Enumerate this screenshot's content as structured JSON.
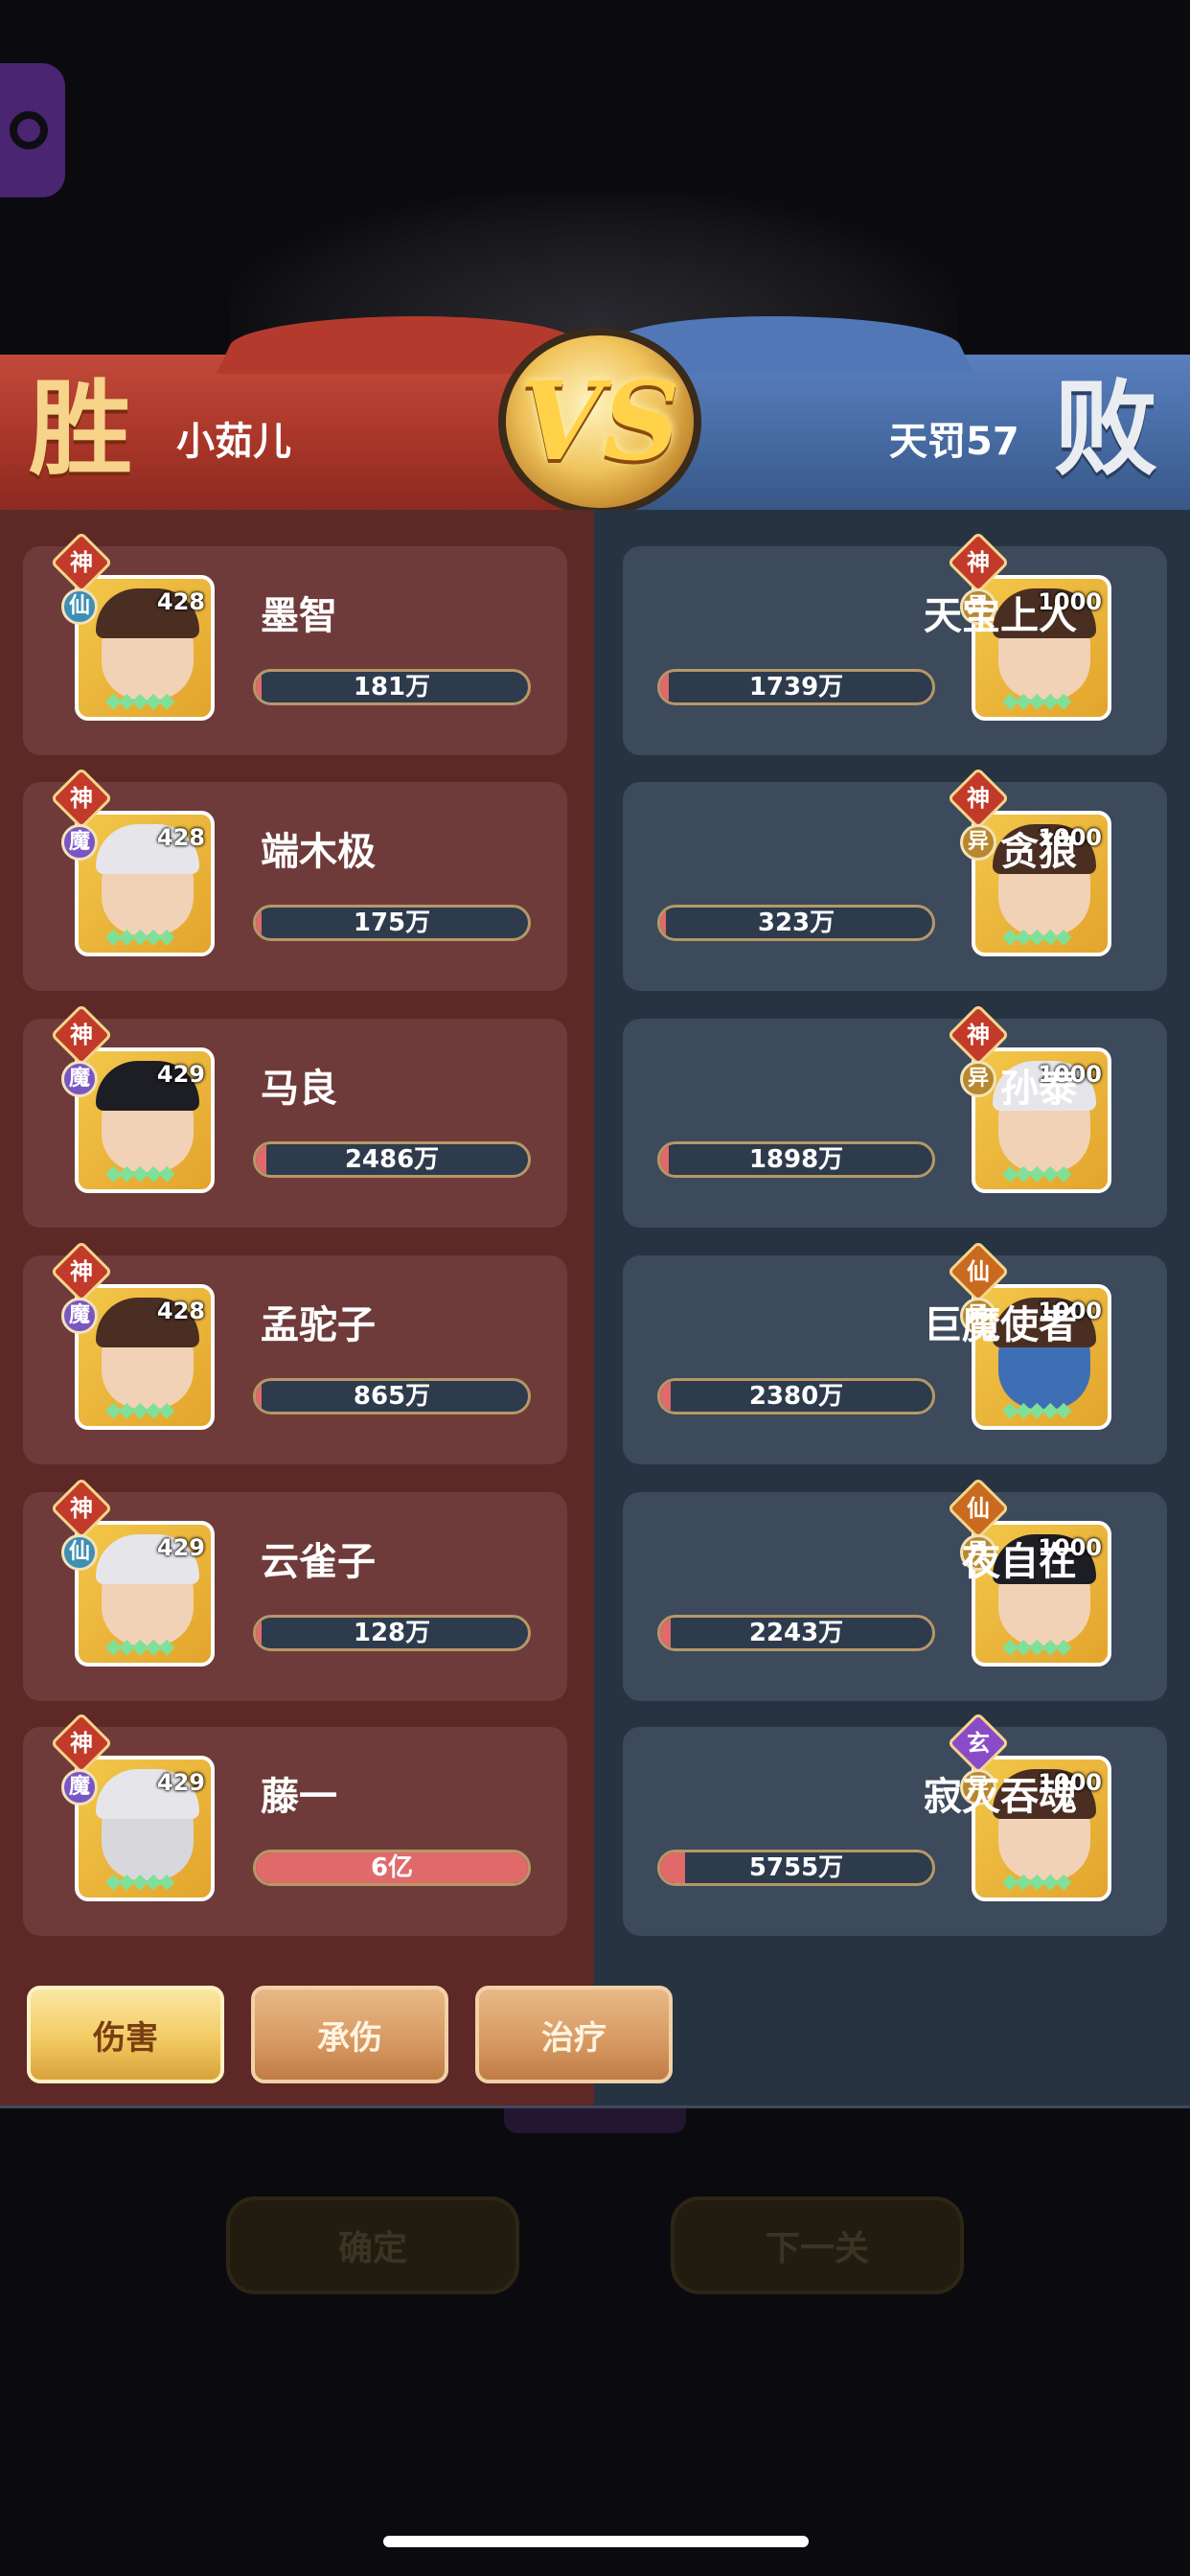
{
  "header": {
    "win_label": "胜",
    "lose_label": "败",
    "left_player": "小茹儿",
    "right_player": "天罚57",
    "vs_label": "VS"
  },
  "left_team": [
    {
      "name": "墨智",
      "level": "428",
      "rank": "神",
      "faction": "仙",
      "value": "181万",
      "fill_pct": 0.0
    },
    {
      "name": "端木极",
      "level": "428",
      "rank": "神",
      "faction": "魔",
      "value": "175万",
      "fill_pct": 0.0
    },
    {
      "name": "马良",
      "level": "429",
      "rank": "神",
      "faction": "魔",
      "value": "2486万",
      "fill_pct": 0.04
    },
    {
      "name": "孟驼子",
      "level": "428",
      "rank": "神",
      "faction": "魔",
      "value": "865万",
      "fill_pct": 0.01
    },
    {
      "name": "云雀子",
      "level": "429",
      "rank": "神",
      "faction": "仙",
      "value": "128万",
      "fill_pct": 0.0
    },
    {
      "name": "藤一",
      "level": "429",
      "rank": "神",
      "faction": "魔",
      "value": "6亿",
      "fill_pct": 1.0
    }
  ],
  "right_team": [
    {
      "name": "天宝上人",
      "level": "1000",
      "rank": "神",
      "faction": "异",
      "value": "1739万",
      "fill_pct": 0.03
    },
    {
      "name": "贪狼",
      "level": "1000",
      "rank": "神",
      "faction": "异",
      "value": "323万",
      "fill_pct": 0.0
    },
    {
      "name": "孙泰",
      "level": "1000",
      "rank": "神",
      "faction": "异",
      "value": "1898万",
      "fill_pct": 0.03
    },
    {
      "name": "巨魔使者",
      "level": "1000",
      "rank": "仙",
      "faction": "异",
      "value": "2380万",
      "fill_pct": 0.04
    },
    {
      "name": "夜自在",
      "level": "1000",
      "rank": "仙",
      "faction": "异",
      "value": "2243万",
      "fill_pct": 0.04
    },
    {
      "name": "寂灭吞魂",
      "level": "1000",
      "rank": "玄",
      "faction": "异",
      "value": "5755万",
      "fill_pct": 0.09
    }
  ],
  "tabs": [
    {
      "label": "伤害",
      "active": true
    },
    {
      "label": "承伤",
      "active": false
    },
    {
      "label": "治疗",
      "active": false
    }
  ],
  "bottom_buttons": {
    "confirm": "确定",
    "next_level": "下一关"
  },
  "icons": {
    "star_glyph": "◆◆◆◆◆"
  },
  "colors": {
    "left_panel": "#5d2826",
    "right_panel": "#283342",
    "bar_fill": "#e06a6a",
    "tab_active": "#f2cb63"
  }
}
